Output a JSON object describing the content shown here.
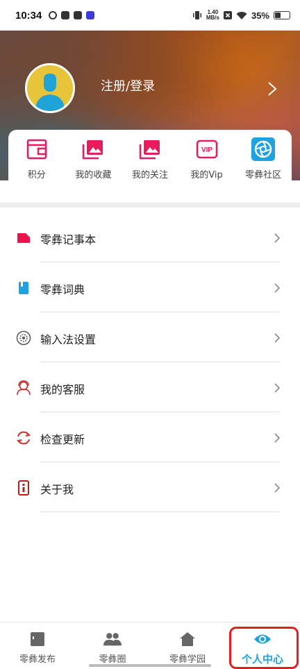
{
  "status_bar": {
    "time": "10:34",
    "net_speed_top": "1.40",
    "net_speed_bottom": "MB/s",
    "battery": "35%"
  },
  "header": {
    "login_label": "注册/登录",
    "avatar_color": "#e8c43a",
    "avatar_figure_color": "#1fa3d6"
  },
  "quick_actions": [
    {
      "label": "积分",
      "icon": "wallet-icon",
      "color": "#e61c5d"
    },
    {
      "label": "我的收藏",
      "icon": "gallery-icon",
      "color": "#e61c5d"
    },
    {
      "label": "我的关注",
      "icon": "gallery-icon",
      "color": "#e61c5d"
    },
    {
      "label": "我的Vip",
      "icon": "vip-icon",
      "color": "#e61c5d"
    },
    {
      "label": "零彝社区",
      "icon": "shutter-icon",
      "color": "#1fa3e0"
    }
  ],
  "menu": [
    {
      "label": "零彝记事本",
      "icon": "note-icon",
      "color": "#e8154e"
    },
    {
      "label": "零彝词典",
      "icon": "dictionary-icon",
      "color": "#1fa3e0"
    },
    {
      "label": "输入法设置",
      "icon": "settings-icon",
      "color": "#555555"
    },
    {
      "label": "我的客服",
      "icon": "customer-service-icon",
      "color": "#c62828"
    },
    {
      "label": "检查更新",
      "icon": "refresh-icon",
      "color": "#d32f2f"
    },
    {
      "label": "关于我",
      "icon": "info-icon",
      "color": "#b71c1c"
    }
  ],
  "bottom_nav": [
    {
      "label": "零彝发布",
      "icon": "publish-icon"
    },
    {
      "label": "零彝圈",
      "icon": "people-icon"
    },
    {
      "label": "零彝学园",
      "icon": "home-icon"
    },
    {
      "label": "个人中心",
      "icon": "eye-icon",
      "active": true
    }
  ],
  "colors": {
    "accent": "#1aa3dc",
    "highlight_outline": "#e02020"
  }
}
